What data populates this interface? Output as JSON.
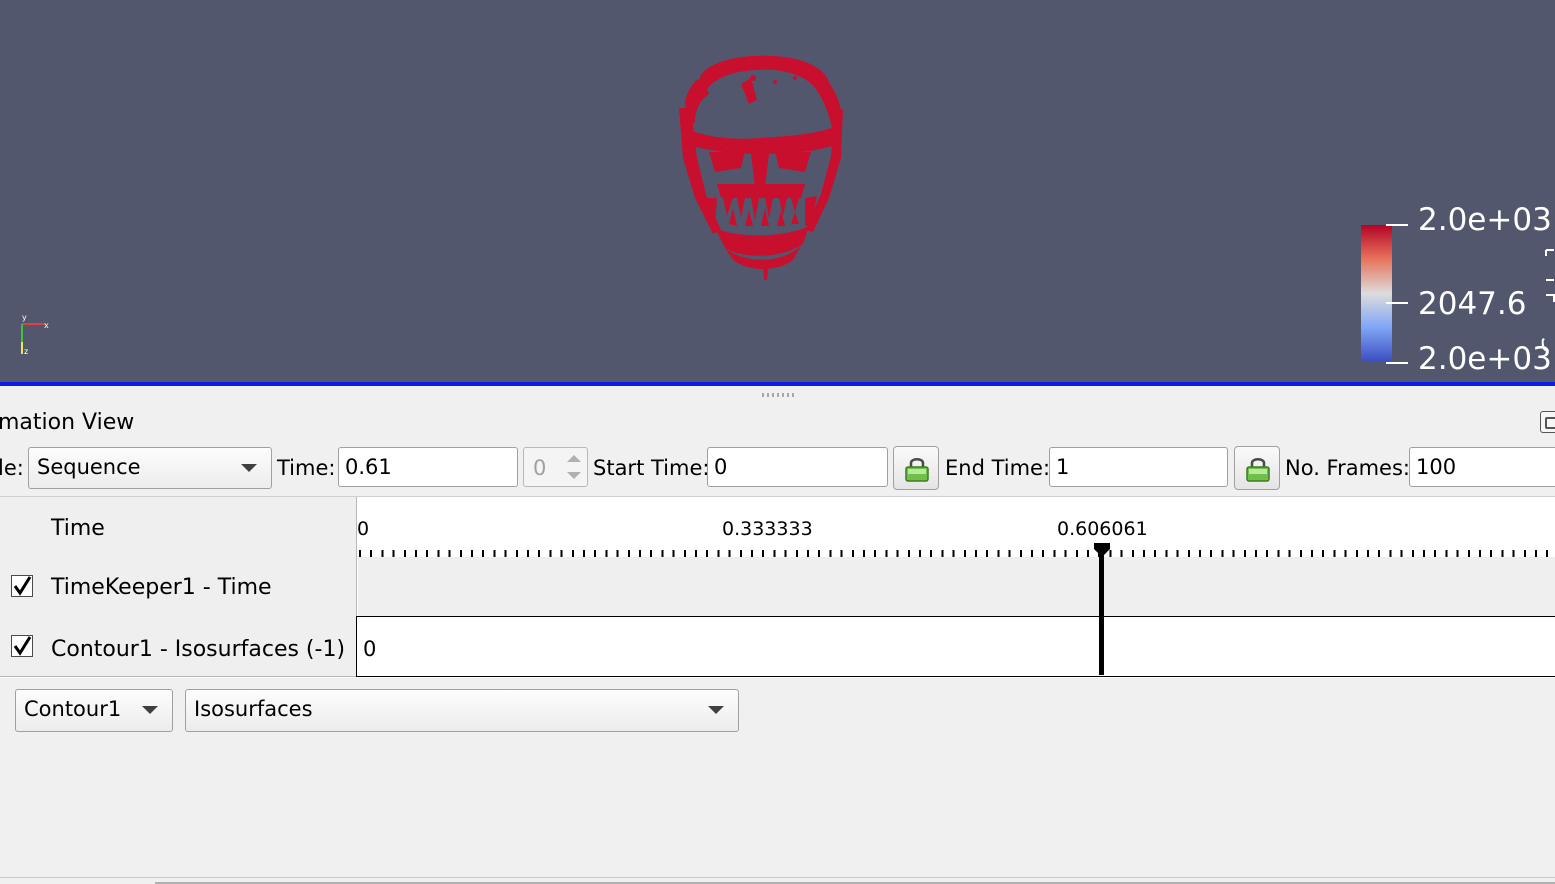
{
  "render_view": {
    "background_color": "#52576e",
    "object_color": "#c8102e",
    "axes_labels": {
      "x": "x",
      "y": "y",
      "z": "z"
    },
    "color_legend": {
      "max_label": "2.0e+03",
      "mid_label": "2047.6",
      "min_label": "2.0e+03",
      "colors": [
        "#b40426",
        "#dddcdc",
        "#3b4cc0"
      ]
    }
  },
  "animation_panel": {
    "title": "mation View",
    "mode_label": "le:",
    "mode_value": "Sequence",
    "time_label": "Time:",
    "time_value": "0.61",
    "time_step_value": "0",
    "start_time_label": "Start Time:",
    "start_time_value": "0",
    "end_time_label": "End Time:",
    "end_time_value": "1",
    "frames_label": "No. Frames:",
    "frames_value": "100"
  },
  "track_table": {
    "header_label": "Time",
    "ruler": {
      "start": "0",
      "mid": "0.333333",
      "current": "0.606061"
    },
    "current_time_fraction": 0.606061,
    "rows": [
      {
        "label": "TimeKeeper1 - Time",
        "checked": true,
        "track_value": ""
      },
      {
        "label": "Contour1 - Isosurfaces (-1)",
        "checked": true,
        "track_value": "0"
      }
    ]
  },
  "add_track": {
    "source_value": "Contour1",
    "property_value": "Isosurfaces"
  }
}
